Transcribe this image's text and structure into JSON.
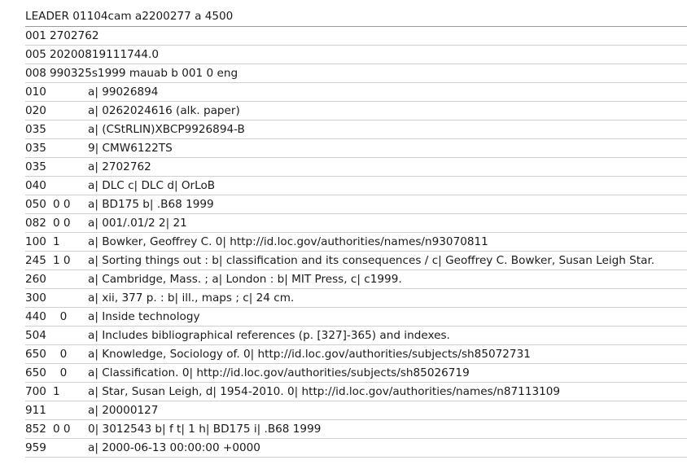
{
  "leader": "LEADER 01104cam a2200277 a 4500",
  "control_fields": [
    {
      "tag": "001",
      "value": "2702762"
    },
    {
      "tag": "005",
      "value": "20200819111744.0"
    },
    {
      "tag": "008",
      "value": "990325s1999 mauab b 001 0 eng"
    }
  ],
  "data_fields": [
    {
      "tag": "010",
      "ind": "",
      "value": "a| 99026894"
    },
    {
      "tag": "020",
      "ind": "",
      "value": "a| 0262024616 (alk. paper)"
    },
    {
      "tag": "035",
      "ind": "",
      "value": "a| (CStRLIN)XBCP9926894-B"
    },
    {
      "tag": "035",
      "ind": "",
      "value": "9| CMW6122TS"
    },
    {
      "tag": "035",
      "ind": "",
      "value": "a| 2702762"
    },
    {
      "tag": "040",
      "ind": "",
      "value": "a| DLC c| DLC d| OrLoB"
    },
    {
      "tag": "050",
      "ind": "0 0",
      "value": "a| BD175 b| .B68 1999"
    },
    {
      "tag": "082",
      "ind": "0 0",
      "value": "a| 001/.01/2 2| 21"
    },
    {
      "tag": "100",
      "ind": "1",
      "value": "a| Bowker, Geoffrey C. 0| http://id.loc.gov/authorities/names/n93070811"
    },
    {
      "tag": "245",
      "ind": "1 0",
      "value": "a| Sorting things out : b| classification and its consequences / c| Geoffrey C. Bowker, Susan Leigh Star."
    },
    {
      "tag": "260",
      "ind": "",
      "value": "a| Cambridge, Mass. ; a| London : b| MIT Press, c| c1999."
    },
    {
      "tag": "300",
      "ind": "",
      "value": "a| xii, 377 p. : b| ill., maps ; c| 24 cm."
    },
    {
      "tag": "440",
      "ind": "  0",
      "value": "a| Inside technology"
    },
    {
      "tag": "504",
      "ind": "",
      "value": "a| Includes bibliographical references (p. [327]-365) and indexes."
    },
    {
      "tag": "650",
      "ind": "  0",
      "value": "a| Knowledge, Sociology of. 0| http://id.loc.gov/authorities/subjects/sh85072731"
    },
    {
      "tag": "650",
      "ind": "  0",
      "value": "a| Classification. 0| http://id.loc.gov/authorities/subjects/sh85026719"
    },
    {
      "tag": "700",
      "ind": "1",
      "value": "a| Star, Susan Leigh, d| 1954-2010. 0| http://id.loc.gov/authorities/names/n87113109"
    },
    {
      "tag": "911",
      "ind": "",
      "value": "a| 20000127"
    },
    {
      "tag": "852",
      "ind": "0 0",
      "value": "0| 3012543 b| f t| 1 h| BD175 i| .B68 1999"
    },
    {
      "tag": "959",
      "ind": "",
      "value": "a| 2000-06-13 00:00:00 +0000"
    }
  ]
}
